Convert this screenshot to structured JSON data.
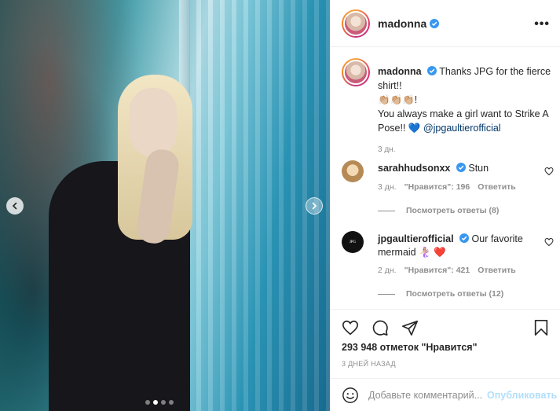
{
  "post": {
    "author": "madonna",
    "verified_icon": "verified-badge-icon",
    "more_icon": "ellipsis-icon",
    "more_label": "•••"
  },
  "caption": {
    "author": "madonna",
    "line1": "Thanks JPG for the fierce shirt!!",
    "emojis": "👏🏼👏🏼👏🏼!",
    "line2": "You always make a girl want to Strike A Pose!! 💙",
    "mention": "@jpgaultierofficial",
    "time": "3 дн."
  },
  "comments": [
    {
      "author": "sarahhudsonxx",
      "text": "Stun",
      "time": "3 дн.",
      "likes": "\"Нравится\": 196",
      "reply_label": "Ответить",
      "view_replies": "Посмотреть ответы (8)"
    },
    {
      "author": "jpgaultierofficial",
      "text": "Our favorite mermaid 🧜🏼‍♀️ ❤️",
      "time": "2 дн.",
      "likes": "\"Нравится\": 421",
      "reply_label": "Ответить",
      "view_replies": "Посмотреть ответы (12)"
    }
  ],
  "actions": {
    "icons": [
      "heart-icon",
      "comment-icon",
      "share-icon",
      "bookmark-icon"
    ],
    "likes_text": "293 948 отметок \"Нравится\"",
    "date_text": "3 ДНЕЙ НАЗАД"
  },
  "add_comment": {
    "placeholder": "Добавьте комментарий...",
    "publish_label": "Опубликовать"
  },
  "carousel": {
    "current": 1,
    "total": 4
  },
  "colors": {
    "link": "#00376b",
    "verified": "#3897f0",
    "muted": "#8e8e8e",
    "publish_disabled": "#b2dffc"
  }
}
